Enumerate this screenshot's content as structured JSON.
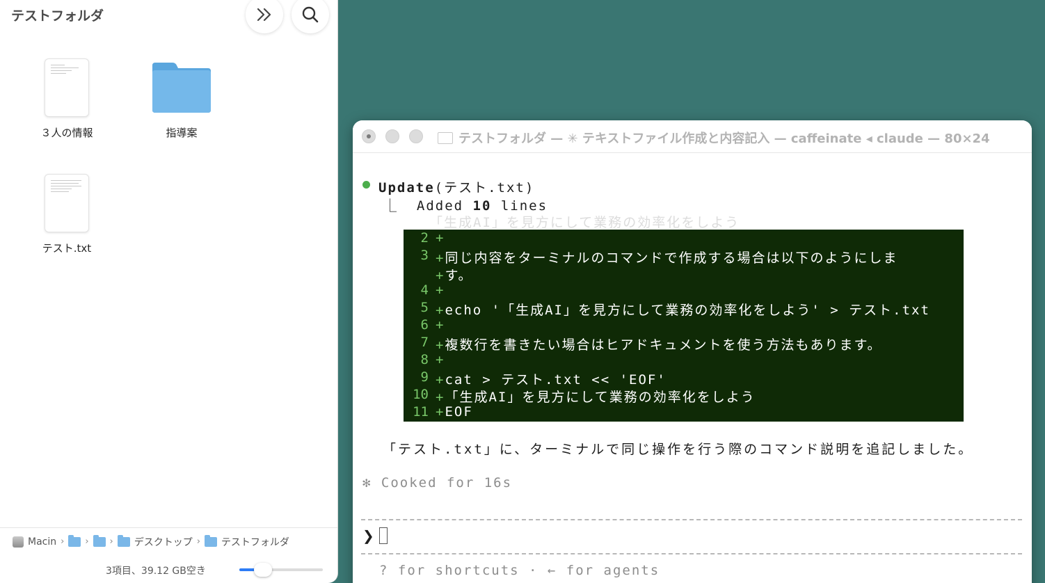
{
  "finder": {
    "title": "テストフォルダ",
    "items": [
      {
        "name": "３人の情報",
        "kind": "document"
      },
      {
        "name": "指導案",
        "kind": "folder"
      },
      {
        "name": "テスト.txt",
        "kind": "document"
      }
    ],
    "path": [
      "Macin",
      "",
      "",
      "デスクトップ",
      "テストフォルダ"
    ],
    "status": "3項目、39.12 GB空き",
    "zoom_level": 0.28,
    "folder_color": "#6fb3e8"
  },
  "terminal": {
    "title": "テストフォルダ — ✳ テキストファイル作成と内容記入 — caffeinate ◂ claude — 80×24",
    "update_tool": "Update",
    "update_arg": "(テスト.txt)",
    "added_prefix": "⎿  Added ",
    "added_count": "10",
    "added_suffix": " lines",
    "ghost_line": "「生成AI」を見方にして業務の効率化をしよう",
    "diff": [
      {
        "num": "2",
        "text": ""
      },
      {
        "num": "3",
        "text": "同じ内容をターミナルのコマンドで作成する場合は以下のようにしま"
      },
      {
        "num": "",
        "text": "す。"
      },
      {
        "num": "4",
        "text": ""
      },
      {
        "num": "5",
        "text": "echo '「生成AI」を見方にして業務の効率化をしよう' > テスト.txt"
      },
      {
        "num": "6",
        "text": ""
      },
      {
        "num": "7",
        "text": "複数行を書きたい場合はヒアドキュメントを使う方法もあります。"
      },
      {
        "num": "8",
        "text": ""
      },
      {
        "num": "9",
        "text": "cat > テスト.txt << 'EOF'"
      },
      {
        "num": "10",
        "text": "「生成AI」を見方にして業務の効率化をしよう"
      },
      {
        "num": "11",
        "text": "EOF"
      }
    ],
    "summary": "「テスト.txt」に、ターミナルで同じ操作を行う際のコマンド説明を追記しました。",
    "cooked": "✻ Cooked for 16s",
    "prompt_symbol": "❯",
    "hint": "? for shortcuts · ← for agents",
    "diff_bg": "#0f2a06",
    "diff_accent": "#79c769"
  }
}
